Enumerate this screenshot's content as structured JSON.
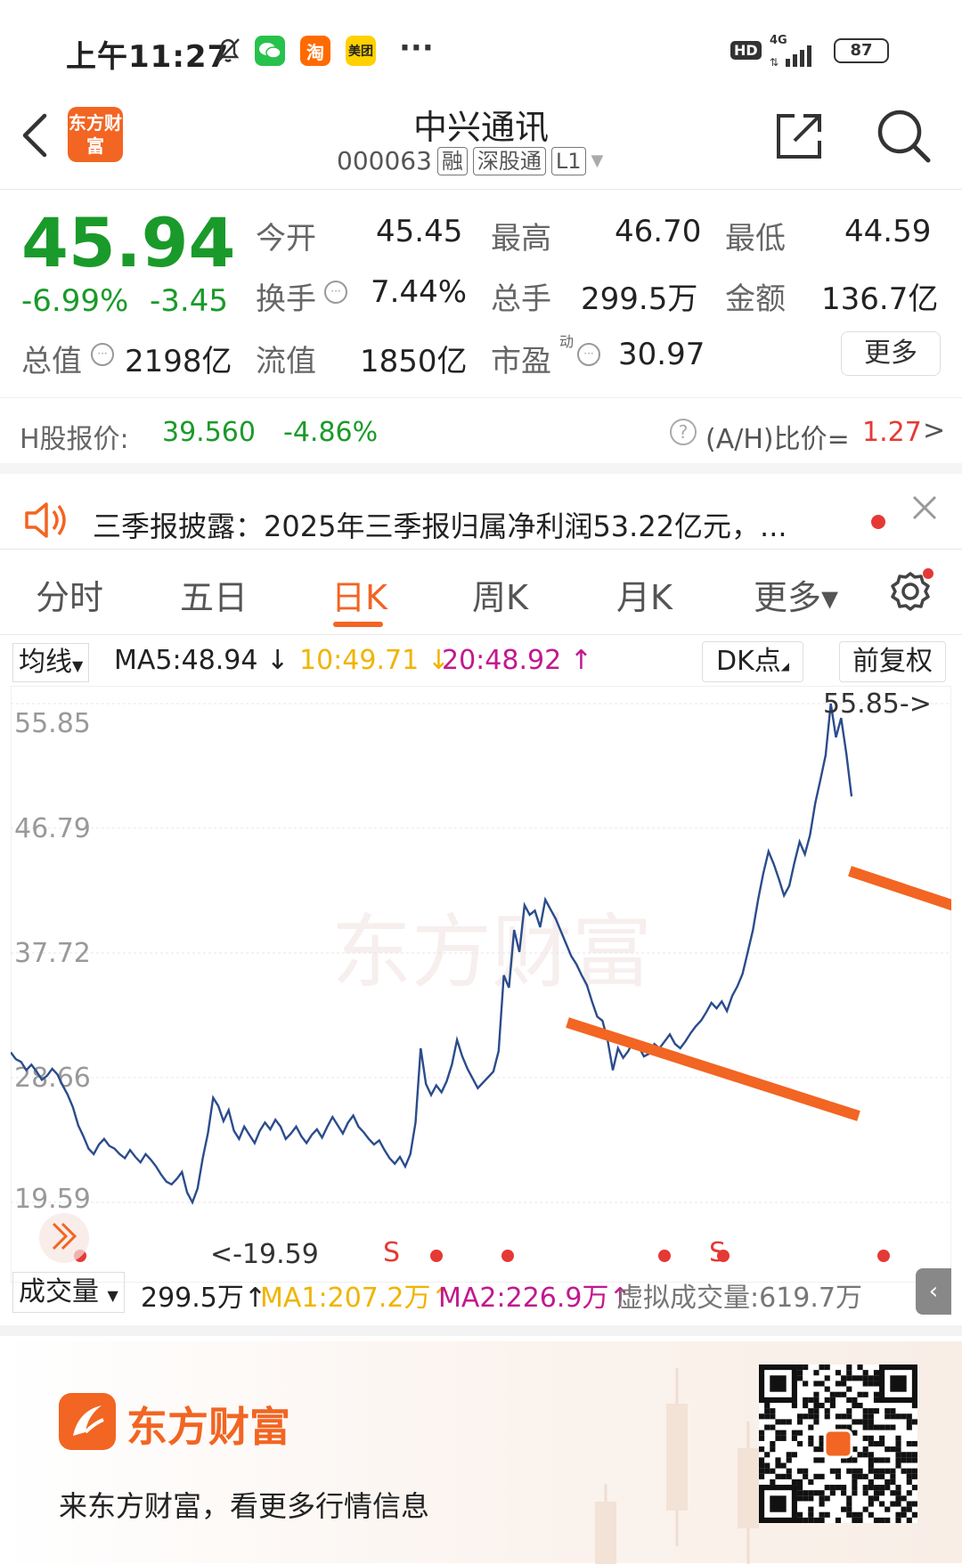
{
  "status_bar": {
    "time": "上午11:27",
    "apps": [
      "bell-off-icon",
      "wechat-icon",
      "taobao-icon",
      "meituan-icon"
    ],
    "taobao_label": "淘",
    "meituan_label": "美团",
    "more": "···",
    "hd": "HD",
    "network": "4G",
    "battery": "87"
  },
  "header": {
    "logo_text": "东方财富",
    "title": "中兴通讯",
    "code": "000063",
    "tags": [
      "融",
      "深股通",
      "L1"
    ]
  },
  "quote": {
    "price": "45.94",
    "change_pct": "-6.99%",
    "change": "-3.45",
    "rows": [
      [
        {
          "label": "今开",
          "value": "45.45"
        },
        {
          "label": "最高",
          "value": "46.70"
        },
        {
          "label": "最低",
          "value": "44.59"
        }
      ],
      [
        {
          "label": "换手",
          "value": "7.44%"
        },
        {
          "label": "总手",
          "value": "299.5万"
        },
        {
          "label": "金额",
          "value": "136.7亿"
        }
      ]
    ],
    "row3": {
      "total_label": "总值",
      "total_value": "2198亿",
      "float_label": "流值",
      "float_value": "1850亿",
      "pe_label": "市盈",
      "pe_sup": "动",
      "pe_value": "30.97"
    },
    "more_btn": "更多"
  },
  "hshare": {
    "label": "H股报价:",
    "price": "39.560",
    "change": "-4.86%",
    "ratio_label": "(A/H)比价=",
    "ratio_value": "1.27",
    "arrow": ">"
  },
  "notice": {
    "text": "三季报披露：2025年三季报归属净利润53.22亿元，..."
  },
  "tabs": [
    {
      "label": "分时"
    },
    {
      "label": "五日"
    },
    {
      "label": "日K",
      "active": true
    },
    {
      "label": "周K"
    },
    {
      "label": "月K"
    },
    {
      "label": "更多▾"
    }
  ],
  "ma_bar": {
    "selector": "均线",
    "ma5": "MA5:48.94",
    "ma10": "10:49.71",
    "ma20": "20:48.92",
    "dk": "DK点",
    "adjust": "前复权",
    "colors": {
      "ma5": "#222222",
      "ma10": "#f0b400",
      "ma20": "#c2188f"
    }
  },
  "chart_data": {
    "type": "line",
    "y_ticks": [
      "55.85",
      "46.79",
      "37.72",
      "28.66",
      "19.59"
    ],
    "ylim": [
      19.59,
      55.85
    ],
    "max_label": "55.85->",
    "min_label": "<-19.59",
    "signals": [
      "S",
      "S"
    ],
    "values": [
      30.5,
      30,
      29.8,
      29.2,
      29.6,
      29.1,
      28.5,
      28.8,
      29.3,
      28.9,
      28.1,
      27.4,
      26.5,
      25.2,
      24.4,
      23.5,
      23.1,
      23.8,
      24.2,
      23.7,
      23.5,
      23.1,
      22.8,
      23.4,
      22.9,
      22.5,
      23.1,
      22.7,
      22.2,
      21.6,
      21.1,
      20.9,
      21.3,
      21.8,
      20.3,
      19.59,
      20.6,
      22.8,
      24.6,
      27.2,
      26.6,
      25.5,
      26.3,
      24.8,
      24.2,
      25.1,
      24.5,
      23.9,
      24.8,
      25.4,
      24.9,
      25.6,
      25.1,
      24.2,
      24.6,
      25.1,
      24.4,
      23.9,
      24.5,
      24.9,
      24.3,
      25.1,
      25.8,
      25.2,
      24.6,
      25.4,
      25.9,
      25.1,
      24.7,
      24.2,
      23.8,
      24.1,
      23.4,
      22.8,
      22.4,
      22.9,
      22.2,
      23.1,
      25.4,
      30.8,
      28.2,
      27.4,
      28.1,
      27.6,
      28.4,
      29.6,
      31.4,
      30.2,
      29.3,
      28.6,
      27.9,
      28.3,
      28.7,
      29.1,
      30.6,
      36.1,
      35.2,
      39.4,
      37.8,
      41.2,
      40.5,
      40.8,
      39.6,
      41.6,
      40.9,
      40.2,
      39.3,
      38.4,
      37.5,
      36.9,
      36.1,
      35.4,
      34.2,
      33.1,
      32.8,
      31.4,
      29.2,
      30.8,
      30.1,
      30.6,
      31.4,
      30.9,
      30.2,
      30.4,
      31.1,
      30.8,
      31.3,
      31.8,
      31.1,
      30.8,
      31.3,
      31.9,
      32.4,
      32.8,
      33.4,
      34.1,
      33.7,
      34.2,
      33.5,
      34.6,
      35.3,
      36.2,
      37.8,
      39.4,
      41.6,
      43.5,
      45.1,
      44.2,
      43.1,
      41.9,
      42.6,
      44.3,
      45.8,
      44.9,
      46.3,
      48.6,
      50.3,
      52.1,
      55.85,
      53.4,
      54.8,
      52.2,
      49.1
    ],
    "ma_lines_drawn": [
      "orange trendline",
      "orange trendline"
    ]
  },
  "volume_bar": {
    "label": "成交量",
    "value": "299.5万",
    "ma1": "MA1:207.2万",
    "ma2": "MA2:226.9万",
    "virtual": "虚拟成交量:619.7万"
  },
  "banner": {
    "brand": "东方财富",
    "slogan": "来东方财富，看更多行情信息"
  }
}
